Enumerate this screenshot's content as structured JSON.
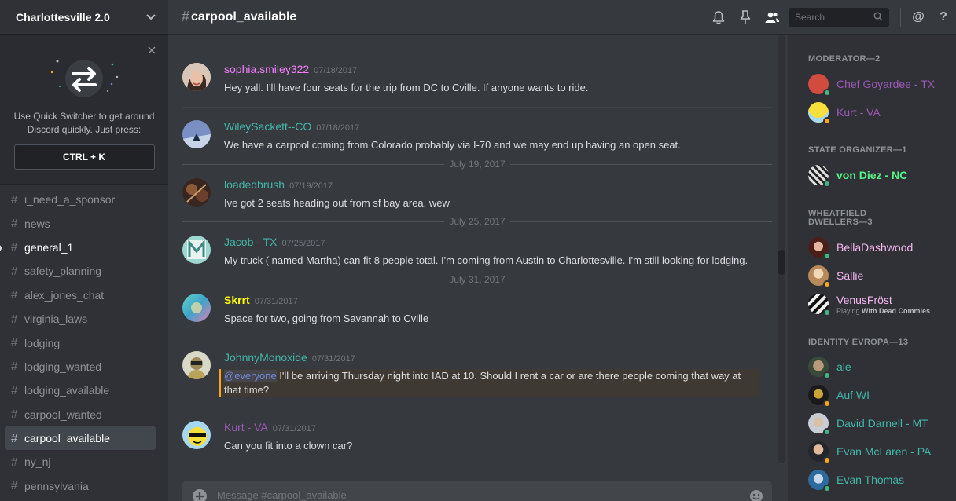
{
  "server": {
    "name": "Charlottesville 2.0"
  },
  "quick_switcher": {
    "text": "Use Quick Switcher to get around Discord quickly. Just press:",
    "shortcut": "CTRL + K"
  },
  "channels": [
    {
      "name": "i_need_a_sponsor"
    },
    {
      "name": "news"
    },
    {
      "name": "general_1"
    },
    {
      "name": "safety_planning"
    },
    {
      "name": "alex_jones_chat"
    },
    {
      "name": "virginia_laws"
    },
    {
      "name": "lodging"
    },
    {
      "name": "lodging_wanted"
    },
    {
      "name": "lodging_available"
    },
    {
      "name": "carpool_wanted"
    },
    {
      "name": "carpool_available"
    },
    {
      "name": "ny_nj"
    },
    {
      "name": "pennsylvania"
    }
  ],
  "header": {
    "hash": "#",
    "channel": "carpool_available",
    "search_placeholder": "Search",
    "mention_icon": "@",
    "help_icon": "?"
  },
  "messages": [
    {
      "user": "sophia.smiley322",
      "color": "#f47fff",
      "time": "07/18/2017",
      "text": "Hey yall. I'll have four seats for the trip from DC to Cville. If anyone wants to ride."
    },
    {
      "user": "WileySackett--CO",
      "color": "#43b5a8",
      "time": "07/18/2017",
      "text": "We have a carpool coming from Colorado probably via I-70 and we may end up having an open seat."
    },
    {
      "user": "loadedbrush",
      "color": "#43b5a8",
      "time": "07/19/2017",
      "text": "Ive got 2 seats heading out from sf bay area, wew"
    },
    {
      "user": "Jacob - TX",
      "color": "#43b5a8",
      "time": "07/25/2017",
      "text": "My truck ( named Martha) can fit 8 people total. I'm coming from Austin to Charlottesville. I'm still looking for lodging."
    },
    {
      "user": "Skrrt",
      "color": "#ffff00",
      "time": "07/31/2017",
      "text": "Space for two, going from Savannah to Cville"
    },
    {
      "user": "JohnnyMonoxide",
      "color": "#43b5a8",
      "time": "07/31/2017",
      "mention": "@everyone",
      "text": " I'll be arriving Thursday night into IAD at 10. Should I rent a car or are there people coming that way at that time?"
    },
    {
      "user": "Kurt - VA",
      "color": "#9b59b6",
      "time": "07/31/2017",
      "text": "Can you fit into a clown car?"
    }
  ],
  "date_dividers": [
    "July 19, 2017",
    "July 25, 2017",
    "July 31, 2017"
  ],
  "composer": {
    "placeholder": "Message #carpool_available"
  },
  "member_groups": [
    {
      "role": "MODERATOR—2",
      "members": [
        {
          "name": "Chef Goyardee - TX",
          "color": "#9b59b6",
          "status": "online"
        },
        {
          "name": "Kurt - VA",
          "color": "#9b59b6",
          "status": "idle"
        }
      ]
    },
    {
      "role": "STATE ORGANIZER—1",
      "members": [
        {
          "name": "von Diez - NC",
          "color": "#57f287",
          "status": "online"
        }
      ]
    },
    {
      "role_line1": "WHEATFIELD",
      "role_line2": "DWELLERS—3",
      "members": [
        {
          "name": "BellaDashwood",
          "color": "#f5b7f0",
          "status": "online"
        },
        {
          "name": "Sallie",
          "color": "#f5b7f0",
          "status": "idle"
        },
        {
          "name": "VenusFröst",
          "color": "#f5b7f0",
          "status": "online",
          "activity_prefix": "Playing ",
          "activity": "With Dead Commies"
        }
      ]
    },
    {
      "role": "IDENTITY EVROPA—13",
      "members": [
        {
          "name": "ale",
          "color": "#43b5a8",
          "status": "online"
        },
        {
          "name": "Auf WI",
          "color": "#43b5a8",
          "status": "idle"
        },
        {
          "name": "David Darnell - MT",
          "color": "#43b5a8",
          "status": "online"
        },
        {
          "name": "Evan McLaren - PA",
          "color": "#43b5a8",
          "status": "idle"
        },
        {
          "name": "Evan Thomas",
          "color": "#43b5a8",
          "status": "online"
        }
      ]
    }
  ]
}
